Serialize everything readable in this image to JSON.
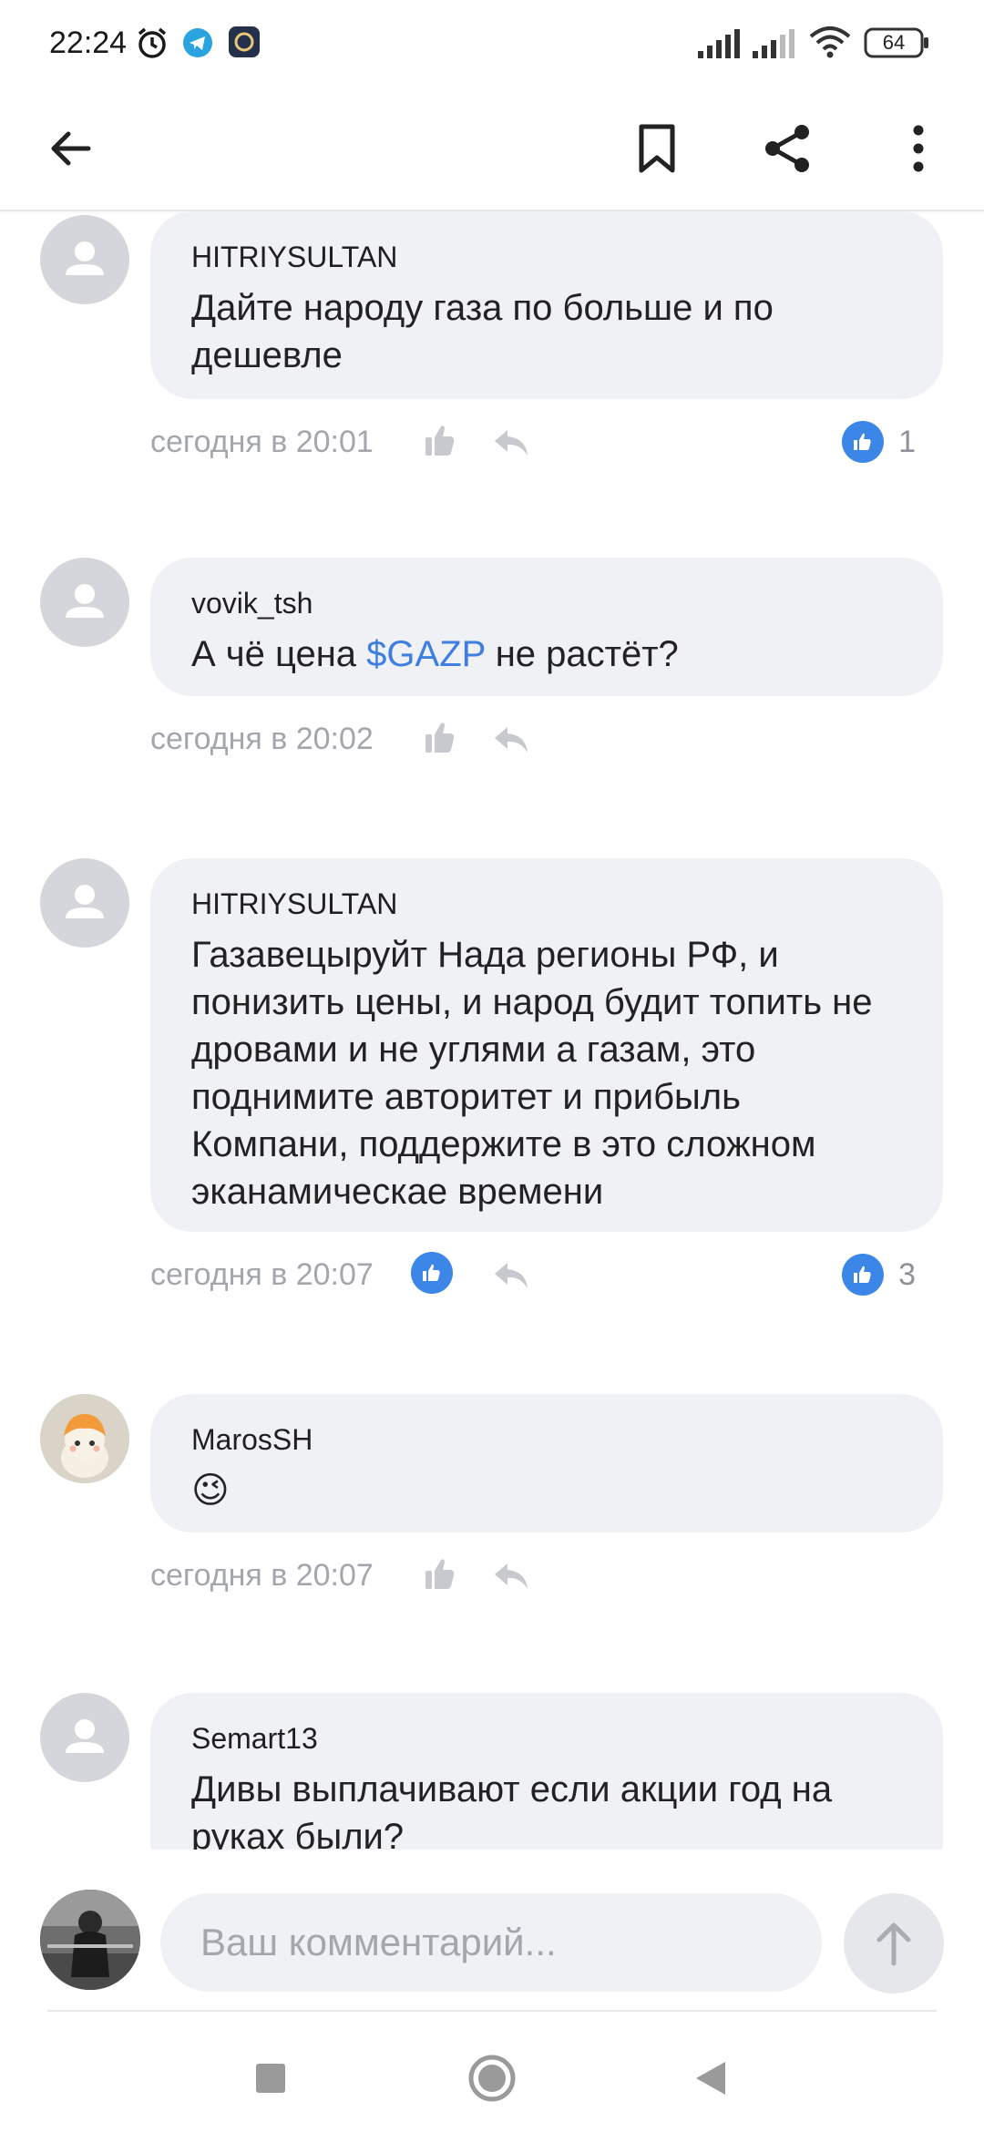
{
  "status_bar": {
    "time": "22:24",
    "battery": "64"
  },
  "header": {
    "back_icon": "back-arrow-icon",
    "bookmark_icon": "bookmark-icon",
    "share_icon": "share-icon",
    "more_icon": "more-vertical-icon"
  },
  "comments": [
    {
      "author": "HITRIYSULTAN",
      "text": "Дайте народу газа по больше и по дешевле",
      "date": "сегодня в 20:01",
      "likes": "1",
      "liked_by_me": false
    },
    {
      "author": "vovik_tsh",
      "text_before": "А чё цена ",
      "ticker": "$GAZP",
      "text_after": " не растёт?",
      "date": "сегодня в 20:02",
      "likes": "",
      "liked_by_me": false
    },
    {
      "author": "HITRIYSULTAN",
      "text": "Газавецыруйт Нада регионы РФ, и понизить цены, и народ будит топить не дровами и не углями а газам, это поднимите авторитет и прибыль Компани, поддержите в это сложном эканамическае времени",
      "date": "сегодня в 20:07",
      "likes": "3",
      "liked_by_me": true
    },
    {
      "author": "MarosSH",
      "text": "😉",
      "date": "сегодня в 20:07",
      "likes": "",
      "liked_by_me": false
    },
    {
      "author": "Semart13",
      "text": "Дивы выплачивают если акции год на руках были?",
      "date": "",
      "likes": "",
      "liked_by_me": false
    }
  ],
  "composer": {
    "placeholder": "Ваш комментарий..."
  },
  "colors": {
    "accent": "#3b86e6",
    "bubble": "#f0f1f4",
    "muted": "#a3a6ad"
  }
}
